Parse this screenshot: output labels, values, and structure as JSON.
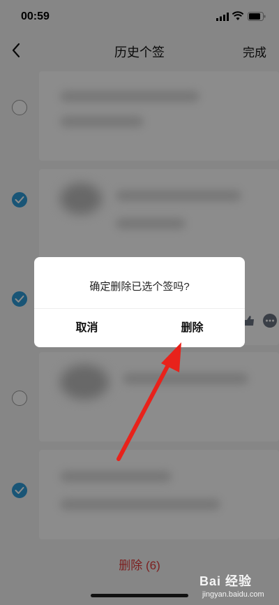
{
  "status_bar": {
    "time": "00:59"
  },
  "nav": {
    "title": "历史个签",
    "done_label": "完成"
  },
  "rows": [
    {
      "checked": false
    },
    {
      "checked": true
    },
    {
      "checked": true
    },
    {
      "checked": false
    },
    {
      "checked": true
    }
  ],
  "footer": {
    "delete_label": "删除 (6)"
  },
  "dialog": {
    "message": "确定删除已选个签吗?",
    "cancel_label": "取消",
    "confirm_label": "删除"
  },
  "watermark": {
    "main": "Bai 经验",
    "sub": "jingyan.baidu.com"
  },
  "colors": {
    "accent": "#2f9bd7",
    "danger": "#e23b3b",
    "annotation_arrow": "#e8221b"
  }
}
